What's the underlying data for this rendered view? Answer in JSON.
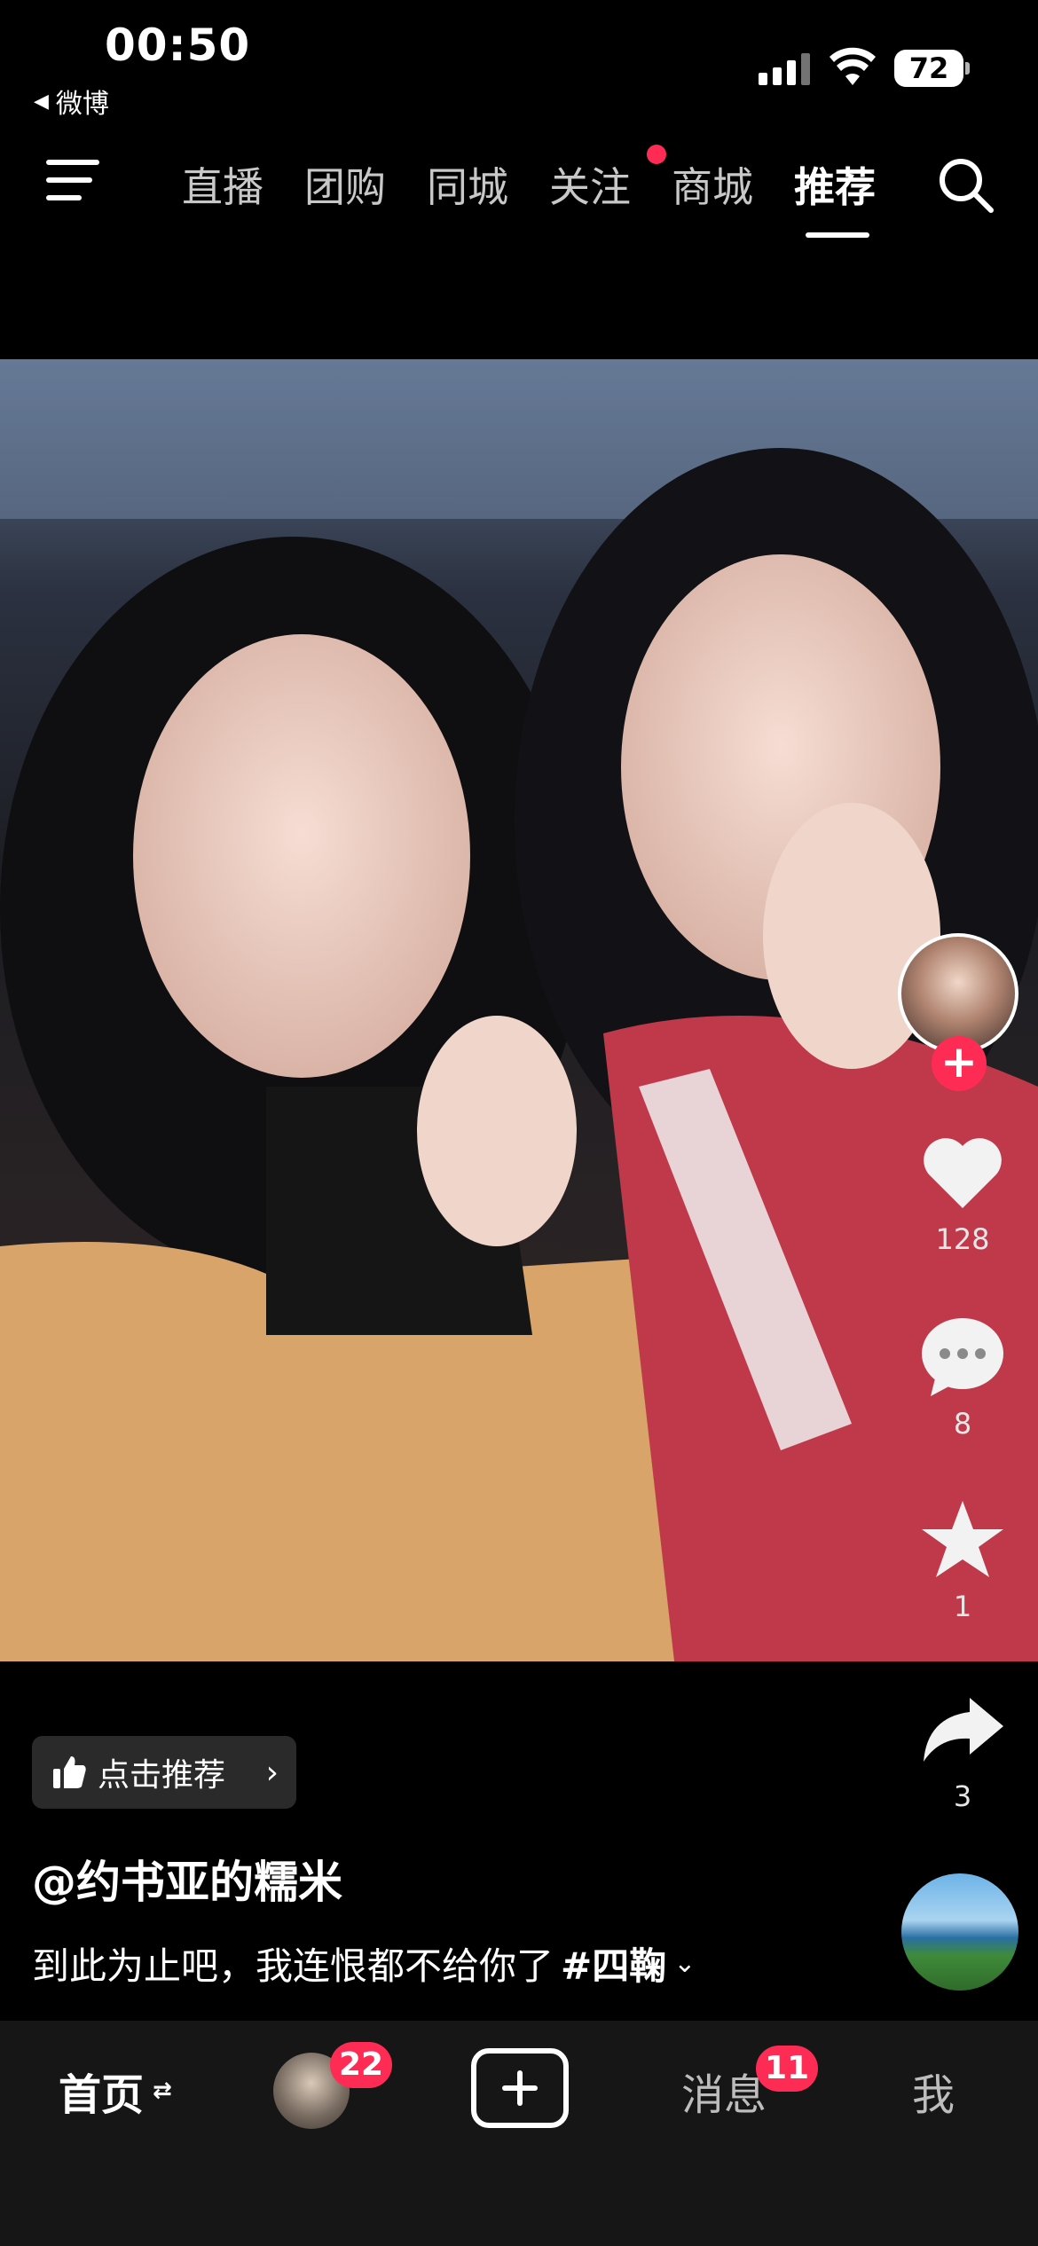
{
  "status_bar": {
    "time": "00:50",
    "back_app": "微博",
    "battery": "72"
  },
  "top_nav": {
    "tabs": [
      {
        "label": "直播",
        "active": false,
        "dot": false
      },
      {
        "label": "团购",
        "active": false,
        "dot": false
      },
      {
        "label": "同城",
        "active": false,
        "dot": false
      },
      {
        "label": "关注",
        "active": false,
        "dot": true
      },
      {
        "label": "商城",
        "active": false,
        "dot": false
      },
      {
        "label": "推荐",
        "active": true,
        "dot": false
      }
    ]
  },
  "actions": {
    "likes": "128",
    "comments": "8",
    "favorites": "1",
    "shares": "3"
  },
  "caption": {
    "recommend_chip": "点击推荐",
    "author": "@约书亚的糯米",
    "description": "到此为止吧，我连恨都不给你了",
    "hashtag": "#四鞠"
  },
  "tab_bar": {
    "home": "首页",
    "friends_badge": "22",
    "messages": "消息",
    "messages_badge": "11",
    "me": "我"
  },
  "colors": {
    "accent": "#fe2c55",
    "background": "#000000",
    "tabbar": "#161616"
  }
}
